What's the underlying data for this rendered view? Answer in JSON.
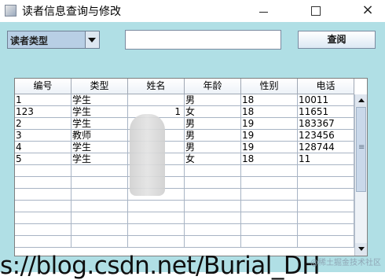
{
  "window": {
    "title": "读者信息查询与修改",
    "close": "×"
  },
  "filter": {
    "selected": "读者类型",
    "search_value": "",
    "search_placeholder": "",
    "query_label": "查阅"
  },
  "table": {
    "columns": [
      "编号",
      "类型",
      "姓名",
      "年龄",
      "性别",
      "电话"
    ],
    "rows": [
      [
        "1",
        "学生",
        "",
        "男",
        "18",
        "10011"
      ],
      [
        "123",
        "学生",
        "1",
        "女",
        "18",
        "11651"
      ],
      [
        "2",
        "学生",
        "",
        "男",
        "19",
        "183367"
      ],
      [
        "3",
        "教师",
        "",
        "男",
        "19",
        "123456"
      ],
      [
        "4",
        "学生",
        "",
        "男",
        "19",
        "128744"
      ],
      [
        "5",
        "学生",
        "",
        "女",
        "18",
        "11"
      ]
    ]
  },
  "watermark": {
    "url_text": "s://blog.csdn.net/Burial_DH",
    "source_text": "@稀土掘金技术社区"
  }
}
